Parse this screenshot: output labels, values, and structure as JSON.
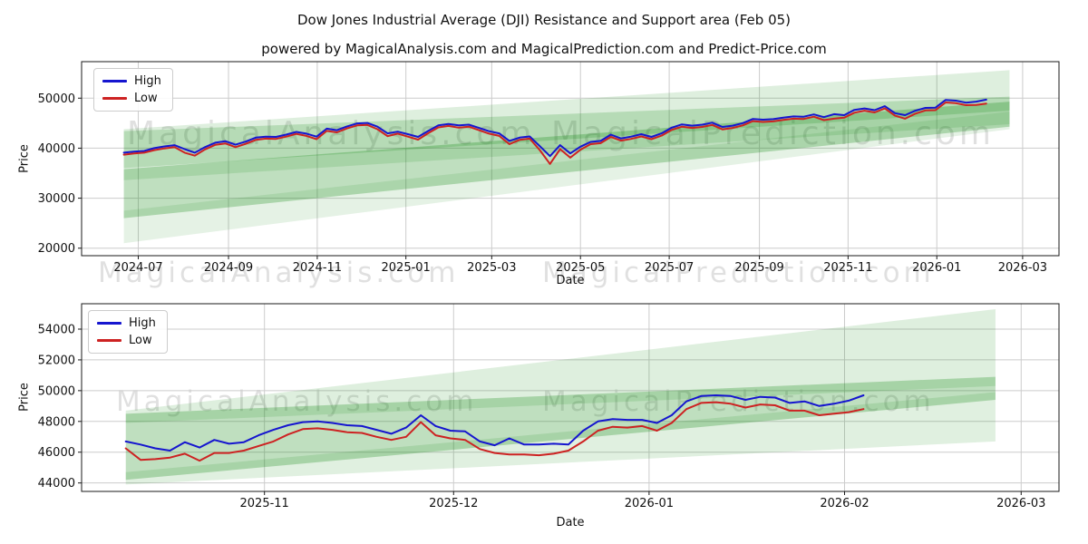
{
  "title": "Dow Jones Industrial Average (DJI) Resistance and Support area (Feb 05)",
  "subtitle": "powered by MagicalAnalysis.com and MagicalPrediction.com and Predict-Price.com",
  "watermarks": {
    "analysis": "MagicalAnalysis.com",
    "prediction": "MagicalPrediction.com"
  },
  "style": {
    "high_color": "#1515cf",
    "low_color": "#cd2222",
    "band_color": "#008000",
    "grid_color": "#cccccc",
    "spine_color": "#1a1a1a"
  },
  "chart_data": [
    {
      "type": "line",
      "name": "full-history",
      "xlabel": "Date",
      "ylabel": "Price",
      "grid": true,
      "legend_position": "upper left",
      "ylim": [
        18500,
        57300
      ],
      "y_ticks": [
        20000,
        30000,
        40000,
        50000
      ],
      "x_ticks": [
        {
          "label": "2024-07",
          "f": 0.058
        },
        {
          "label": "2024-09",
          "f": 0.1503
        },
        {
          "label": "2024-11",
          "f": 0.2411
        },
        {
          "label": "2025-01",
          "f": 0.3318
        },
        {
          "label": "2025-03",
          "f": 0.4196
        },
        {
          "label": "2025-05",
          "f": 0.5104
        },
        {
          "label": "2025-07",
          "f": 0.6012
        },
        {
          "label": "2025-09",
          "f": 0.6935
        },
        {
          "label": "2025-11",
          "f": 0.7842
        },
        {
          "label": "2026-01",
          "f": 0.875
        },
        {
          "label": "2026-03",
          "f": 0.9628
        }
      ],
      "legend": [
        {
          "label": "High",
          "color": "#1515cf"
        },
        {
          "label": "Low",
          "color": "#cd2222"
        }
      ],
      "dates": [
        "2024-06-21",
        "2024-06-28",
        "2024-07-05",
        "2024-07-12",
        "2024-07-19",
        "2024-07-26",
        "2024-08-02",
        "2024-08-09",
        "2024-08-16",
        "2024-08-23",
        "2024-08-30",
        "2024-09-06",
        "2024-09-13",
        "2024-09-20",
        "2024-09-27",
        "2024-10-04",
        "2024-10-11",
        "2024-10-18",
        "2024-10-25",
        "2024-11-01",
        "2024-11-08",
        "2024-11-15",
        "2024-11-22",
        "2024-11-29",
        "2024-12-06",
        "2024-12-13",
        "2024-12-20",
        "2024-12-27",
        "2025-01-03",
        "2025-01-10",
        "2025-01-17",
        "2025-01-24",
        "2025-01-31",
        "2025-02-07",
        "2025-02-14",
        "2025-02-21",
        "2025-02-28",
        "2025-03-07",
        "2025-03-14",
        "2025-03-21",
        "2025-03-28",
        "2025-04-04",
        "2025-04-11",
        "2025-04-18",
        "2025-04-25",
        "2025-05-02",
        "2025-05-09",
        "2025-05-16",
        "2025-05-23",
        "2025-05-30",
        "2025-06-06",
        "2025-06-13",
        "2025-06-20",
        "2025-06-27",
        "2025-07-04",
        "2025-07-11",
        "2025-07-18",
        "2025-07-25",
        "2025-08-01",
        "2025-08-08",
        "2025-08-15",
        "2025-08-22",
        "2025-08-29",
        "2025-09-05",
        "2025-09-12",
        "2025-09-19",
        "2025-09-26",
        "2025-10-03",
        "2025-10-10",
        "2025-10-17",
        "2025-10-24",
        "2025-10-31",
        "2025-11-07",
        "2025-11-14",
        "2025-11-21",
        "2025-11-28",
        "2025-12-05",
        "2025-12-12",
        "2025-12-19",
        "2025-12-26",
        "2026-01-02",
        "2026-01-09",
        "2026-01-16",
        "2026-01-23",
        "2026-01-30",
        "2026-02-04"
      ],
      "series": [
        {
          "name": "High",
          "color": "#1515cf",
          "f0": 0.0432,
          "f1": 0.9256,
          "values": [
            39100,
            39300,
            39450,
            40000,
            40350,
            40600,
            39800,
            39100,
            40200,
            41100,
            41400,
            40700,
            41300,
            42100,
            42300,
            42250,
            42700,
            43250,
            42900,
            42300,
            43900,
            43600,
            44350,
            44950,
            45050,
            44300,
            42950,
            43300,
            42800,
            42250,
            43450,
            44550,
            44850,
            44550,
            44700,
            44050,
            43400,
            42950,
            41450,
            42100,
            42350,
            40400,
            38400,
            40600,
            38950,
            40300,
            41250,
            41450,
            42700,
            41950,
            42300,
            42800,
            42250,
            42950,
            44100,
            44750,
            44500,
            44700,
            45100,
            44250,
            44500,
            45000,
            45850,
            45700,
            45800,
            46100,
            46350,
            46300,
            46750,
            46200,
            46800,
            46600,
            47650,
            47950,
            47600,
            48400,
            47000,
            46600,
            47500,
            48050,
            48100,
            49650,
            49500,
            49100,
            49300,
            49700
          ]
        },
        {
          "name": "Low",
          "color": "#cd2222",
          "f0": 0.0432,
          "f1": 0.9256,
          "values": [
            38700,
            38950,
            39100,
            39600,
            39950,
            40200,
            39100,
            38500,
            39750,
            40650,
            40950,
            40200,
            40850,
            41650,
            41900,
            41850,
            42300,
            42850,
            42450,
            41800,
            43450,
            43150,
            43950,
            44550,
            44650,
            43800,
            42400,
            42900,
            42300,
            41700,
            43000,
            44150,
            44450,
            44100,
            44300,
            43600,
            42900,
            42450,
            40800,
            41650,
            41900,
            39600,
            36850,
            39800,
            38100,
            39700,
            40800,
            41000,
            42250,
            41500,
            41850,
            42350,
            41800,
            42500,
            43650,
            44300,
            44050,
            44250,
            44650,
            43750,
            44050,
            44550,
            45400,
            45250,
            45350,
            45650,
            45900,
            45850,
            46300,
            45600,
            45900,
            46100,
            47100,
            47500,
            47150,
            47950,
            46500,
            45900,
            46900,
            47550,
            47600,
            49150,
            49000,
            48600,
            48650,
            48900
          ]
        }
      ],
      "bands": [
        {
          "alpha": 0.13,
          "f0": 0.0432,
          "f1": 0.9494,
          "top0": 43800,
          "bot0": 33600,
          "top1": 55600,
          "bot1": 44800
        },
        {
          "alpha": 0.18,
          "f0": 0.0432,
          "f1": 0.9494,
          "top0": 43400,
          "bot0": 36000,
          "top1": 50300,
          "bot1": 47500
        },
        {
          "alpha": 0.25,
          "f0": 0.0432,
          "f1": 0.9494,
          "top0": 35800,
          "bot0": 26000,
          "top1": 49300,
          "bot1": 44300
        },
        {
          "alpha": 0.1,
          "f0": 0.0432,
          "f1": 0.9494,
          "top0": 27500,
          "bot0": 21000,
          "top1": 47300,
          "bot1": 43800
        }
      ]
    },
    {
      "type": "line",
      "name": "recent-zoom",
      "xlabel": "Date",
      "ylabel": "Price",
      "grid": true,
      "legend_position": "upper left",
      "ylim": [
        43450,
        55650
      ],
      "y_ticks": [
        44000,
        46000,
        48000,
        50000,
        52000,
        54000
      ],
      "x_ticks": [
        {
          "label": "2025-11",
          "f": 0.1871
        },
        {
          "label": "2025-12",
          "f": 0.3806
        },
        {
          "label": "2026-01",
          "f": 0.5806
        },
        {
          "label": "2026-02",
          "f": 0.7806
        },
        {
          "label": "2026-03",
          "f": 0.9613
        }
      ],
      "legend": [
        {
          "label": "High",
          "color": "#1515cf"
        },
        {
          "label": "Low",
          "color": "#cd2222"
        }
      ],
      "dates": [
        "2025-10-10",
        "2025-10-13",
        "2025-10-15",
        "2025-10-17",
        "2025-10-20",
        "2025-10-22",
        "2025-10-24",
        "2025-10-27",
        "2025-10-29",
        "2025-10-31",
        "2025-11-03",
        "2025-11-05",
        "2025-11-07",
        "2025-11-10",
        "2025-11-12",
        "2025-11-14",
        "2025-11-17",
        "2025-11-19",
        "2025-11-21",
        "2025-11-24",
        "2025-11-26",
        "2025-11-28",
        "2025-12-01",
        "2025-12-03",
        "2025-12-05",
        "2025-12-08",
        "2025-12-10",
        "2025-12-12",
        "2025-12-15",
        "2025-12-17",
        "2025-12-19",
        "2025-12-22",
        "2025-12-24",
        "2025-12-26",
        "2025-12-29",
        "2025-12-31",
        "2026-01-02",
        "2026-01-05",
        "2026-01-07",
        "2026-01-09",
        "2026-01-12",
        "2026-01-14",
        "2026-01-16",
        "2026-01-19",
        "2026-01-21",
        "2026-01-23",
        "2026-01-26",
        "2026-01-28",
        "2026-01-30",
        "2026-02-02",
        "2026-02-04"
      ],
      "series": [
        {
          "name": "High",
          "color": "#1515cf",
          "f0": 0.0452,
          "f1": 0.8,
          "values": [
            46700,
            46500,
            46250,
            46100,
            46650,
            46300,
            46800,
            46550,
            46650,
            47100,
            47450,
            47750,
            47950,
            48000,
            47900,
            47750,
            47700,
            47450,
            47200,
            47600,
            48400,
            47700,
            47400,
            47350,
            46700,
            46450,
            46900,
            46500,
            46500,
            46550,
            46500,
            47400,
            48000,
            48150,
            48100,
            48100,
            47900,
            48400,
            49300,
            49650,
            49700,
            49650,
            49400,
            49600,
            49550,
            49200,
            49300,
            49000,
            49150,
            49350,
            49700
          ]
        },
        {
          "name": "Low",
          "color": "#cd2222",
          "f0": 0.0452,
          "f1": 0.8,
          "values": [
            46250,
            45500,
            45550,
            45650,
            45900,
            45450,
            45950,
            45950,
            46100,
            46400,
            46700,
            47150,
            47500,
            47550,
            47450,
            47300,
            47250,
            47000,
            46800,
            47000,
            47950,
            47100,
            46900,
            46800,
            46200,
            45950,
            45850,
            45850,
            45800,
            45900,
            46100,
            46700,
            47400,
            47650,
            47600,
            47700,
            47400,
            47900,
            48800,
            49200,
            49250,
            49150,
            48900,
            49100,
            49050,
            48700,
            48700,
            48400,
            48500,
            48600,
            48800
          ]
        }
      ],
      "bands": [
        {
          "alpha": 0.13,
          "f0": 0.0452,
          "f1": 0.935,
          "top0": 48700,
          "bot0": 47900,
          "top1": 55300,
          "bot1": 50300
        },
        {
          "alpha": 0.25,
          "f0": 0.0452,
          "f1": 0.935,
          "top0": 48500,
          "bot0": 44200,
          "top1": 50900,
          "bot1": 49400
        },
        {
          "alpha": 0.12,
          "f0": 0.0452,
          "f1": 0.935,
          "top0": 44700,
          "bot0": 43900,
          "top1": 49900,
          "bot1": 46700
        }
      ]
    }
  ]
}
